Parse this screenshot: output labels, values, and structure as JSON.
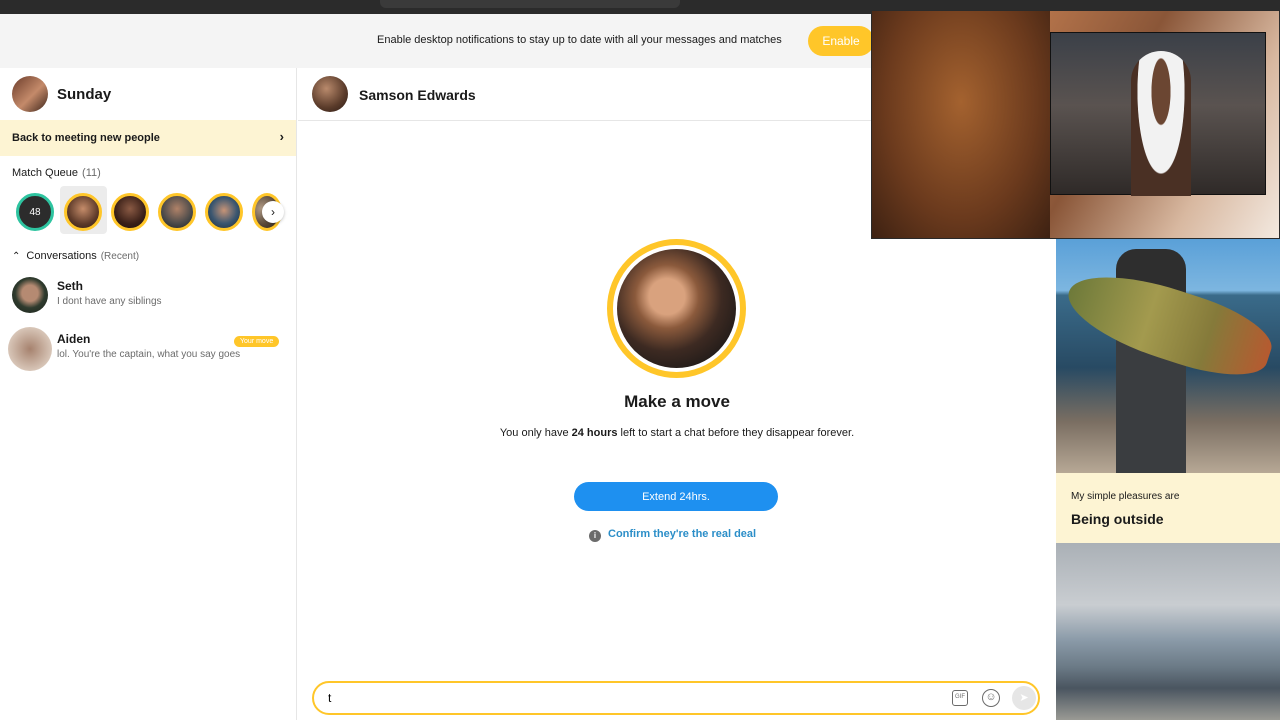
{
  "notification": {
    "text": "Enable desktop notifications to stay up to date with all your messages and matches",
    "button": "Enable"
  },
  "sidebar": {
    "user_name": "Sunday",
    "back_label": "Back to meeting new people",
    "match_queue": {
      "title": "Match Queue",
      "count": "(11)",
      "first_badge": "48"
    },
    "conversations": {
      "title": "Conversations",
      "subtitle": "(Recent)",
      "items": [
        {
          "name": "Seth",
          "message": "I dont have any siblings"
        },
        {
          "name": "Aiden",
          "message": "lol. You're the captain, what you say goes",
          "badge": "Your move"
        }
      ]
    }
  },
  "chat": {
    "name": "Samson Edwards",
    "title": "Make a move",
    "desc_before": "You only have ",
    "desc_bold": "24 hours",
    "desc_after": " left to start a chat before they disappear forever.",
    "extend_button": "Extend 24hrs.",
    "confirm_link": "Confirm they're the real deal",
    "input_value": "t"
  },
  "profile": {
    "prompt_label": "My simple pleasures are",
    "prompt_value": "Being outside"
  },
  "colors": {
    "accent": "#ffc629",
    "primary_blue": "#1e90f0",
    "link_blue": "#2b8ec8",
    "highlight_bg": "#fdf4d3"
  },
  "icons": [
    "chevron-right-icon",
    "chevron-up-icon",
    "info-icon",
    "gif-icon",
    "emoji-icon",
    "send-icon"
  ]
}
